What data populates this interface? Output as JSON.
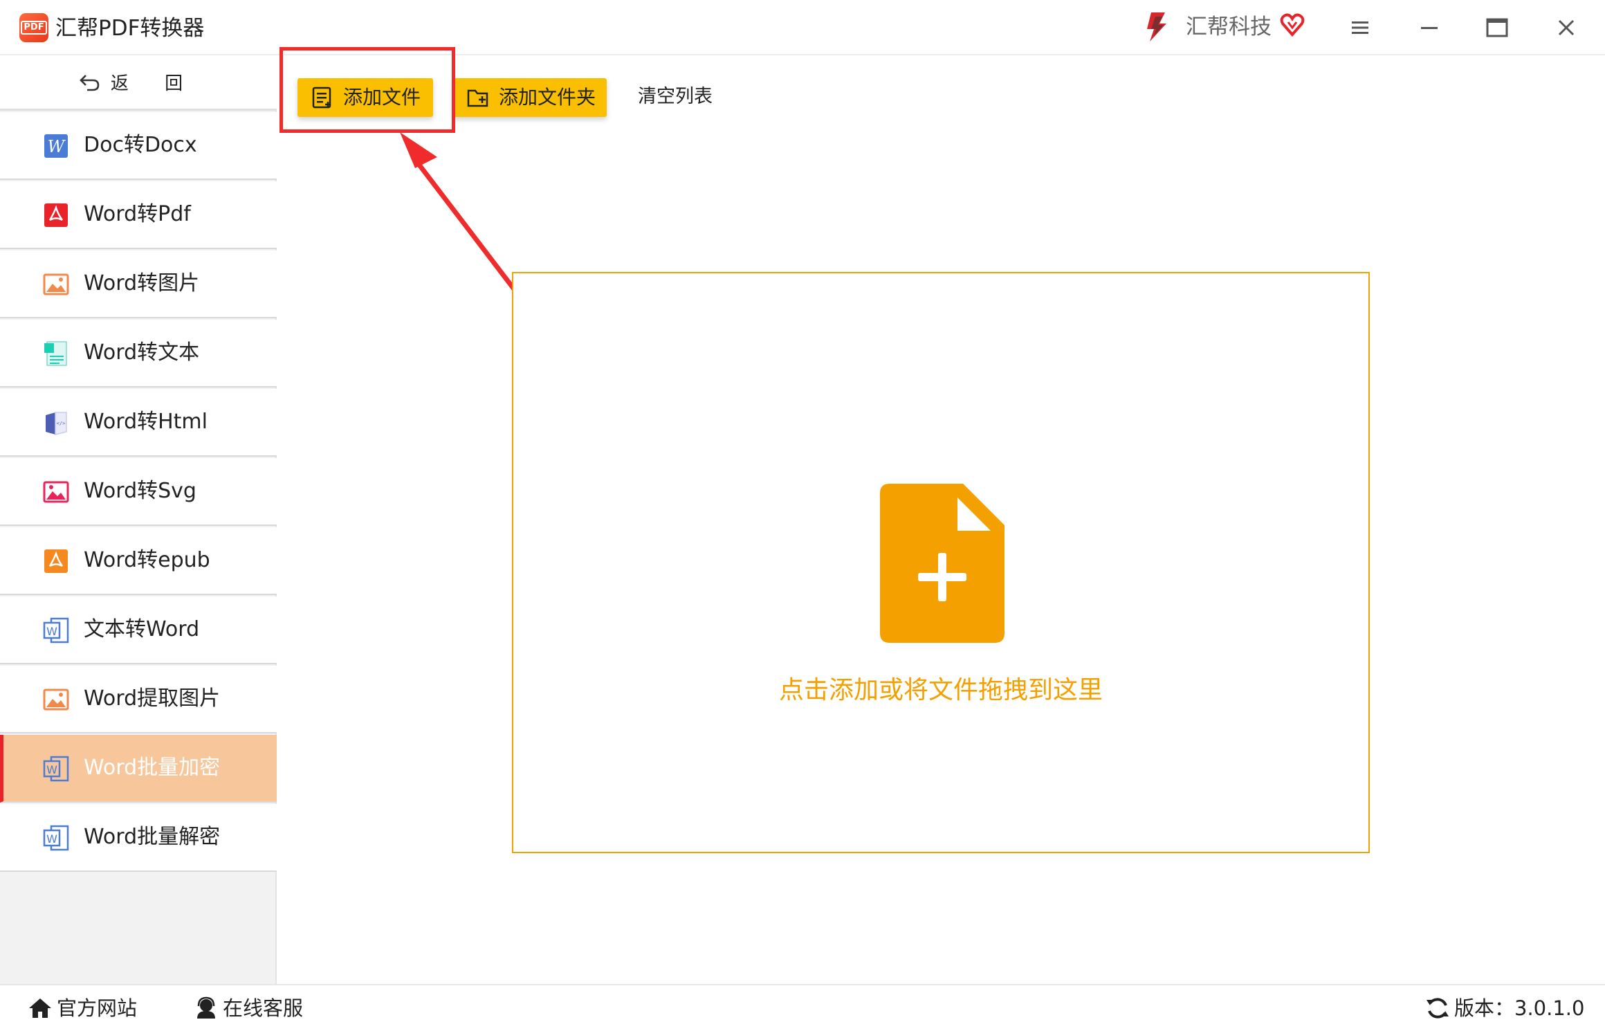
{
  "window": {
    "title": "汇帮PDF转换器",
    "logo_text": "PDF",
    "brand_name": "汇帮科技"
  },
  "sidebar": {
    "back_label": "返 回",
    "items": [
      {
        "label": "Doc转Docx",
        "icon": "word-icon",
        "active": false
      },
      {
        "label": "Word转Pdf",
        "icon": "pdf-icon",
        "active": false
      },
      {
        "label": "Word转图片",
        "icon": "image-icon",
        "active": false
      },
      {
        "label": "Word转文本",
        "icon": "text-file-icon",
        "active": false
      },
      {
        "label": "Word转Html",
        "icon": "html-book-icon",
        "active": false
      },
      {
        "label": "Word转Svg",
        "icon": "svg-image-icon",
        "active": false
      },
      {
        "label": "Word转epub",
        "icon": "epub-icon",
        "active": false
      },
      {
        "label": "文本转Word",
        "icon": "word-doc-icon",
        "active": false
      },
      {
        "label": "Word提取图片",
        "icon": "image-extract-icon",
        "active": false
      },
      {
        "label": "Word批量加密",
        "icon": "word-doc-icon",
        "active": true
      },
      {
        "label": "Word批量解密",
        "icon": "word-doc-icon",
        "active": false
      }
    ]
  },
  "toolbar": {
    "add_file_label": "添加文件",
    "add_folder_label": "添加文件夹",
    "clear_list_label": "清空列表"
  },
  "dropzone": {
    "hint": "点击添加或将文件拖拽到这里"
  },
  "footer": {
    "website_label": "官方网站",
    "support_label": "在线客服",
    "version_label": "版本：3.0.1.0"
  },
  "colors": {
    "accent": "#f9bf00",
    "drop_border": "#f3a000",
    "active_item": "#f7c79b",
    "annotation_red": "#ef2b2b"
  }
}
